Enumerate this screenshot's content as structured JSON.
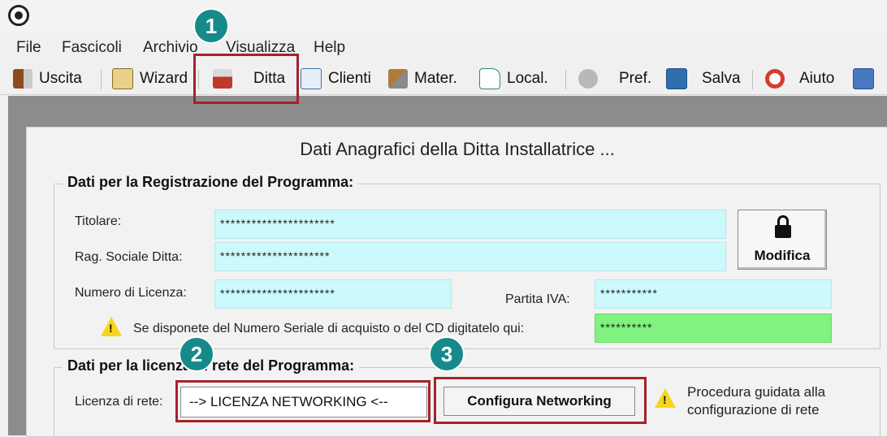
{
  "menu": [
    "File",
    "Fascicoli",
    "Archivio",
    "Visualizza",
    "Help"
  ],
  "toolbar": {
    "uscita": "Uscita",
    "wizard": "Wizard",
    "ditta": "Ditta",
    "clienti": "Clienti",
    "mater": "Mater.",
    "local": "Local.",
    "pref": "Pref.",
    "salva": "Salva",
    "aiuto": "Aiuto"
  },
  "panel": {
    "title": "Dati Anagrafici della Ditta Installatrice ...",
    "registration": {
      "title": "Dati per la Registrazione del Programma:",
      "titolare_label": "Titolare:",
      "titolare_value": "**********************",
      "ragione_label": "Rag. Sociale Ditta:",
      "ragione_value": "*********************",
      "licenza_label": "Numero di Licenza:",
      "licenza_value": "**********************",
      "iva_label": "Partita IVA:",
      "iva_value": "***********",
      "seriale_text": "Se disponete del Numero Seriale di acquisto o del CD digitatelo qui:",
      "seriale_value": "**********",
      "modifica_label": "Modifica"
    },
    "network": {
      "title": "Dati per la licenza di rete del Programma:",
      "licenza_label": "Licenza di rete:",
      "licenza_value": "--> LICENZA NETWORKING  <--",
      "configura_label": "Configura Networking",
      "procedura_line1": "Procedura guidata alla",
      "procedura_line2": "configurazione di rete"
    }
  },
  "badges": [
    "1",
    "2",
    "3"
  ],
  "colors": {
    "field": "#ccf9fb",
    "serial_field": "#7ff27f",
    "highlight": "#a3232b",
    "badge": "#168a8a"
  }
}
